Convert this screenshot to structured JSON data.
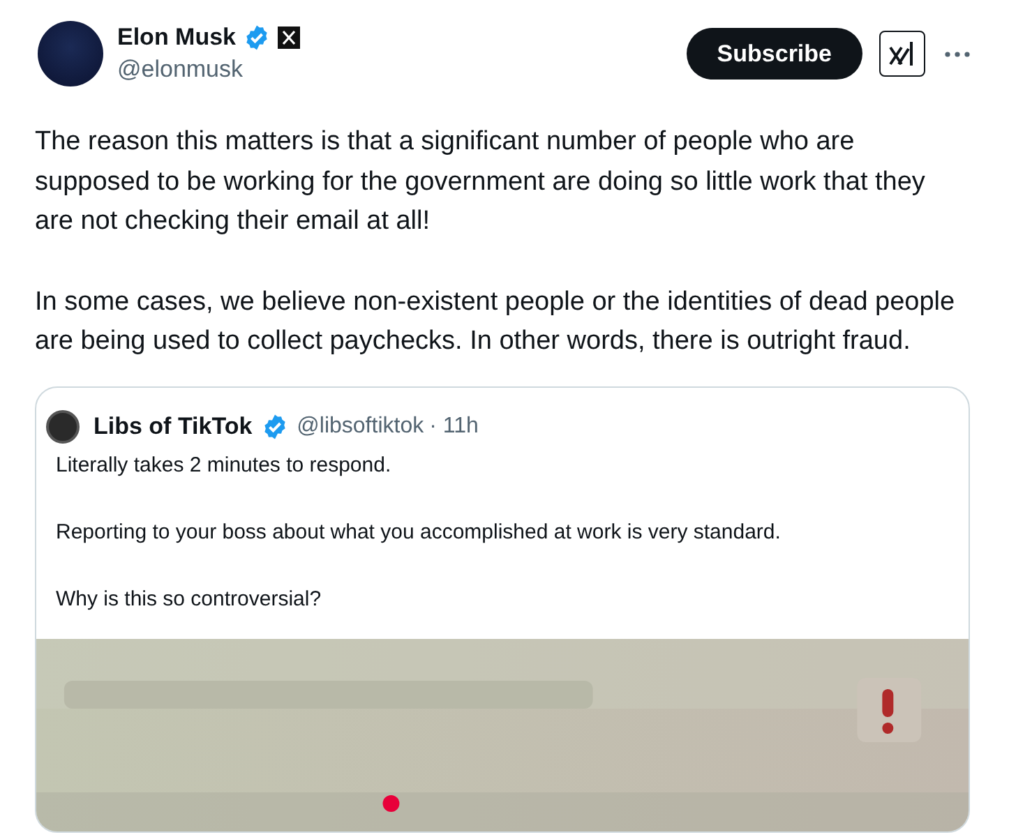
{
  "post": {
    "author": {
      "name": "Elon Musk",
      "handle": "@elonmusk",
      "verified": true,
      "affiliate_badge": true
    },
    "subscribe_button": "Subscribe",
    "paragraphs": [
      "The reason this matters is that a significant number of people who are supposed to be working for the government are doing so little work that they are not checking their email at all!",
      "In some cases, we believe non-existent people or the identities of dead people are being used to collect paychecks. In other words, there is outright fraud."
    ],
    "quoted_post": {
      "author": {
        "name": "Libs of TikTok",
        "handle": "@libsoftiktok",
        "verified": true
      },
      "time": "· 11h",
      "paragraphs": [
        "Literally takes 2 minutes to respond.",
        "Reporting to your boss about what you accomplished at work is very standard.",
        "Why is this so controversial?"
      ]
    }
  }
}
